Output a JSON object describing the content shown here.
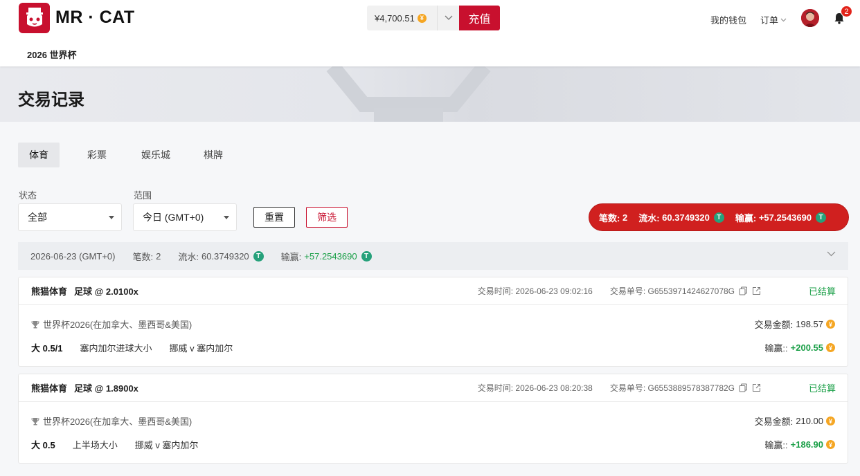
{
  "header": {
    "brand": "MR · CAT",
    "nav_link": "2026 世界杯",
    "balance": "¥4,700.51",
    "recharge_label": "充值",
    "wallet_label": "我的钱包",
    "orders_label": "订单",
    "notification_count": "2"
  },
  "page": {
    "title": "交易记录"
  },
  "tabs": [
    {
      "label": "体育",
      "active": true
    },
    {
      "label": "彩票",
      "active": false
    },
    {
      "label": "娱乐城",
      "active": false
    },
    {
      "label": "棋牌",
      "active": false
    }
  ],
  "filters": {
    "status_label": "状态",
    "status_value": "全部",
    "range_label": "范围",
    "range_value": "今日 (GMT+0)",
    "reset_label": "重置",
    "filter_label": "筛选"
  },
  "summary": {
    "count_label": "笔数:",
    "count": "2",
    "turnover_label": "流水:",
    "turnover": "60.3749320",
    "winloss_label": "输赢:",
    "winloss": "+57.2543690"
  },
  "day": {
    "date": "2026-06-23 (GMT+0)",
    "count_label": "笔数:",
    "count": "2",
    "turnover_label": "流水:",
    "turnover": "60.3749320",
    "winloss_label": "输赢:",
    "winloss": "+57.2543690"
  },
  "labels": {
    "time_label": "交易时间:",
    "order_label": "交易单号:",
    "amount_label": "交易金额:",
    "winloss_label": "输赢::"
  },
  "transactions": [
    {
      "provider": "熊猫体育",
      "sport_odds": "足球 @ 2.0100x",
      "time": "2026-06-23 09:02:16",
      "order_no": "G6553971424627078G",
      "status": "已结算",
      "league": "世界杯2026(在加拿大、墨西哥&美国)",
      "selection": "大 0.5/1",
      "market": "塞内加尔进球大小",
      "match": "挪威 v 塞内加尔",
      "amount": "198.57",
      "winloss": "+200.55"
    },
    {
      "provider": "熊猫体育",
      "sport_odds": "足球 @ 1.8900x",
      "time": "2026-06-23 08:20:38",
      "order_no": "G6553889578387782G",
      "status": "已结算",
      "league": "世界杯2026(在加拿大、墨西哥&美国)",
      "selection": "大 0.5",
      "market": "上半场大小",
      "match": "挪威 v 塞内加尔",
      "amount": "210.00",
      "winloss": "+186.90"
    }
  ],
  "colors": {
    "brand_red": "#c8102e",
    "win_green": "#1a9f47",
    "usdt_green": "#26a17b",
    "coin_gold": "#f5a623"
  }
}
